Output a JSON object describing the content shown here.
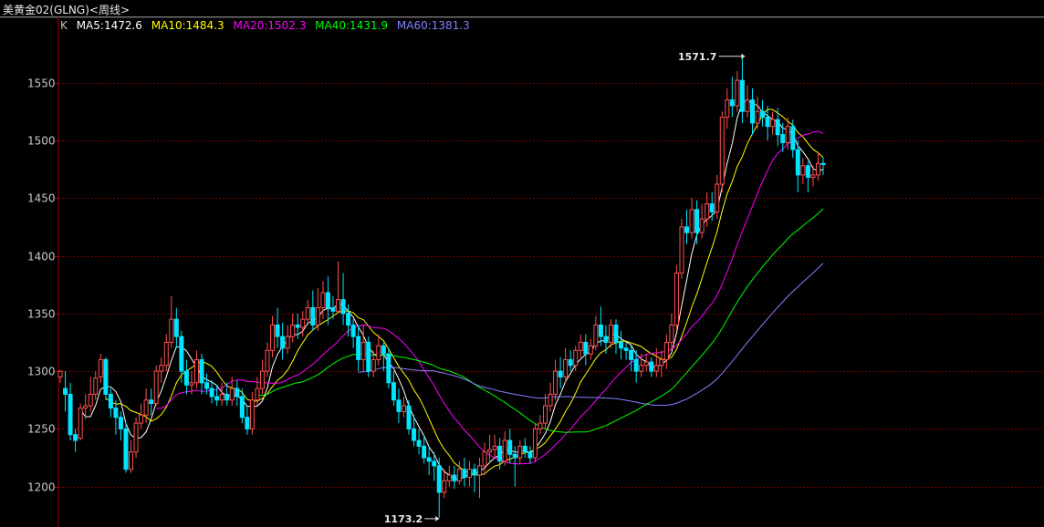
{
  "window": {
    "title": "美黄金02(GLNG)<周线>"
  },
  "legend": {
    "k_label": "K",
    "items": [
      {
        "label": "MA5:1472.6",
        "color": "#ffffff"
      },
      {
        "label": "MA10:1484.3",
        "color": "#ffff00"
      },
      {
        "label": "MA20:1502.3",
        "color": "#ff00ff"
      },
      {
        "label": "MA40:1431.9",
        "color": "#00ff00"
      },
      {
        "label": "MA60:1381.3",
        "color": "#8080ff"
      }
    ]
  },
  "colors": {
    "up": "#ff5050",
    "down": "#00e5ff",
    "grid": "#7a0000",
    "axis": "#b00000"
  },
  "chart_data": {
    "type": "candlestick",
    "ylim": [
      1165,
      1590
    ],
    "yticks": [
      1200,
      1250,
      1300,
      1350,
      1400,
      1450,
      1500,
      1550
    ],
    "high_marker": "1571.7",
    "low_marker": "1173.2",
    "high": 1571.7,
    "low": 1173.2,
    "candles": [
      [
        1295,
        1300,
        1290,
        1301
      ],
      [
        1285,
        1280,
        1265,
        1300
      ],
      [
        1280,
        1245,
        1240,
        1290
      ],
      [
        1245,
        1240,
        1230,
        1250
      ],
      [
        1242,
        1268,
        1240,
        1272
      ],
      [
        1268,
        1270,
        1258,
        1280
      ],
      [
        1270,
        1280,
        1265,
        1295
      ],
      [
        1280,
        1294,
        1275,
        1300
      ],
      [
        1295,
        1310,
        1290,
        1315
      ],
      [
        1310,
        1280,
        1275,
        1312
      ],
      [
        1280,
        1268,
        1260,
        1285
      ],
      [
        1268,
        1260,
        1245,
        1275
      ],
      [
        1260,
        1250,
        1240,
        1265
      ],
      [
        1250,
        1215,
        1212,
        1256
      ],
      [
        1215,
        1230,
        1212,
        1240
      ],
      [
        1230,
        1255,
        1225,
        1260
      ],
      [
        1255,
        1262,
        1250,
        1272
      ],
      [
        1262,
        1275,
        1255,
        1285
      ],
      [
        1275,
        1272,
        1262,
        1285
      ],
      [
        1272,
        1300,
        1270,
        1305
      ],
      [
        1300,
        1305,
        1290,
        1312
      ],
      [
        1305,
        1325,
        1300,
        1332
      ],
      [
        1325,
        1345,
        1320,
        1365
      ],
      [
        1345,
        1330,
        1320,
        1355
      ],
      [
        1330,
        1300,
        1290,
        1335
      ],
      [
        1300,
        1288,
        1280,
        1310
      ],
      [
        1288,
        1290,
        1280,
        1300
      ],
      [
        1290,
        1310,
        1285,
        1318
      ],
      [
        1310,
        1290,
        1280,
        1315
      ],
      [
        1290,
        1285,
        1280,
        1298
      ],
      [
        1285,
        1278,
        1272,
        1292
      ],
      [
        1278,
        1275,
        1270,
        1288
      ],
      [
        1275,
        1280,
        1270,
        1290
      ],
      [
        1280,
        1275,
        1270,
        1290
      ],
      [
        1275,
        1285,
        1270,
        1295
      ],
      [
        1285,
        1278,
        1270,
        1292
      ],
      [
        1278,
        1260,
        1255,
        1285
      ],
      [
        1260,
        1250,
        1245,
        1270
      ],
      [
        1250,
        1275,
        1245,
        1282
      ],
      [
        1275,
        1285,
        1270,
        1295
      ],
      [
        1285,
        1300,
        1280,
        1310
      ],
      [
        1300,
        1318,
        1295,
        1325
      ],
      [
        1318,
        1340,
        1312,
        1348
      ],
      [
        1340,
        1330,
        1320,
        1355
      ],
      [
        1330,
        1320,
        1310,
        1342
      ],
      [
        1320,
        1330,
        1315,
        1340
      ],
      [
        1330,
        1340,
        1325,
        1350
      ],
      [
        1340,
        1338,
        1328,
        1350
      ],
      [
        1338,
        1345,
        1330,
        1352
      ],
      [
        1345,
        1355,
        1340,
        1362
      ],
      [
        1355,
        1340,
        1335,
        1370
      ],
      [
        1340,
        1355,
        1335,
        1372
      ],
      [
        1355,
        1368,
        1345,
        1378
      ],
      [
        1368,
        1355,
        1340,
        1382
      ],
      [
        1355,
        1352,
        1345,
        1365
      ],
      [
        1352,
        1362,
        1350,
        1395
      ],
      [
        1362,
        1350,
        1340,
        1385
      ],
      [
        1350,
        1340,
        1330,
        1358
      ],
      [
        1340,
        1330,
        1320,
        1345
      ],
      [
        1330,
        1310,
        1300,
        1340
      ],
      [
        1310,
        1325,
        1300,
        1340
      ],
      [
        1325,
        1300,
        1295,
        1330
      ],
      [
        1300,
        1310,
        1295,
        1318
      ],
      [
        1310,
        1322,
        1305,
        1332
      ],
      [
        1322,
        1315,
        1300,
        1325
      ],
      [
        1315,
        1290,
        1285,
        1320
      ],
      [
        1290,
        1275,
        1270,
        1300
      ],
      [
        1275,
        1265,
        1255,
        1285
      ],
      [
        1265,
        1270,
        1260,
        1278
      ],
      [
        1270,
        1250,
        1245,
        1275
      ],
      [
        1250,
        1240,
        1235,
        1262
      ],
      [
        1240,
        1235,
        1228,
        1250
      ],
      [
        1235,
        1225,
        1220,
        1245
      ],
      [
        1225,
        1222,
        1210,
        1235
      ],
      [
        1222,
        1218,
        1205,
        1230
      ],
      [
        1218,
        1195,
        1173,
        1225
      ],
      [
        1195,
        1205,
        1190,
        1215
      ],
      [
        1205,
        1210,
        1200,
        1218
      ],
      [
        1210,
        1205,
        1198,
        1218
      ],
      [
        1205,
        1215,
        1202,
        1222
      ],
      [
        1215,
        1208,
        1200,
        1225
      ],
      [
        1208,
        1215,
        1200,
        1222
      ],
      [
        1215,
        1210,
        1195,
        1220
      ],
      [
        1210,
        1218,
        1190,
        1225
      ],
      [
        1218,
        1230,
        1210,
        1238
      ],
      [
        1230,
        1232,
        1220,
        1245
      ],
      [
        1232,
        1235,
        1225,
        1245
      ],
      [
        1235,
        1222,
        1215,
        1242
      ],
      [
        1222,
        1240,
        1218,
        1248
      ],
      [
        1240,
        1228,
        1220,
        1250
      ],
      [
        1228,
        1225,
        1200,
        1235
      ],
      [
        1225,
        1235,
        1220,
        1240
      ],
      [
        1235,
        1230,
        1225,
        1242
      ],
      [
        1230,
        1225,
        1220,
        1235
      ],
      [
        1225,
        1250,
        1222,
        1255
      ],
      [
        1250,
        1255,
        1245,
        1262
      ],
      [
        1255,
        1270,
        1250,
        1280
      ],
      [
        1270,
        1280,
        1265,
        1290
      ],
      [
        1280,
        1300,
        1275,
        1310
      ],
      [
        1300,
        1295,
        1285,
        1312
      ],
      [
        1295,
        1310,
        1290,
        1320
      ],
      [
        1310,
        1305,
        1300,
        1318
      ],
      [
        1305,
        1318,
        1300,
        1322
      ],
      [
        1318,
        1325,
        1312,
        1332
      ],
      [
        1325,
        1315,
        1305,
        1332
      ],
      [
        1315,
        1322,
        1310,
        1328
      ],
      [
        1322,
        1340,
        1318,
        1348
      ],
      [
        1340,
        1330,
        1322,
        1356
      ],
      [
        1330,
        1325,
        1315,
        1340
      ],
      [
        1325,
        1340,
        1320,
        1345
      ],
      [
        1340,
        1325,
        1315,
        1345
      ],
      [
        1325,
        1320,
        1310,
        1335
      ],
      [
        1320,
        1318,
        1310,
        1325
      ],
      [
        1318,
        1310,
        1300,
        1322
      ],
      [
        1310,
        1300,
        1290,
        1318
      ],
      [
        1300,
        1305,
        1295,
        1315
      ],
      [
        1305,
        1308,
        1300,
        1315
      ],
      [
        1308,
        1300,
        1295,
        1312
      ],
      [
        1300,
        1305,
        1295,
        1320
      ],
      [
        1305,
        1310,
        1295,
        1318
      ],
      [
        1310,
        1325,
        1302,
        1332
      ],
      [
        1325,
        1340,
        1318,
        1350
      ],
      [
        1340,
        1385,
        1335,
        1392
      ],
      [
        1385,
        1425,
        1380,
        1432
      ],
      [
        1425,
        1420,
        1410,
        1440
      ],
      [
        1420,
        1440,
        1415,
        1450
      ],
      [
        1440,
        1420,
        1410,
        1448
      ],
      [
        1420,
        1432,
        1415,
        1445
      ],
      [
        1432,
        1445,
        1425,
        1455
      ],
      [
        1445,
        1438,
        1430,
        1455
      ],
      [
        1438,
        1462,
        1432,
        1470
      ],
      [
        1462,
        1520,
        1455,
        1525
      ],
      [
        1520,
        1535,
        1510,
        1545
      ],
      [
        1535,
        1530,
        1520,
        1555
      ],
      [
        1530,
        1552,
        1525,
        1560
      ],
      [
        1552,
        1525,
        1515,
        1572
      ],
      [
        1525,
        1535,
        1520,
        1548
      ],
      [
        1535,
        1515,
        1505,
        1545
      ],
      [
        1515,
        1525,
        1510,
        1538
      ],
      [
        1525,
        1520,
        1512,
        1535
      ],
      [
        1520,
        1512,
        1500,
        1530
      ],
      [
        1512,
        1518,
        1505,
        1525
      ],
      [
        1518,
        1505,
        1495,
        1528
      ],
      [
        1505,
        1498,
        1490,
        1515
      ],
      [
        1498,
        1512,
        1492,
        1520
      ],
      [
        1512,
        1492,
        1485,
        1518
      ],
      [
        1492,
        1470,
        1455,
        1500
      ],
      [
        1470,
        1478,
        1462,
        1485
      ],
      [
        1478,
        1468,
        1455,
        1482
      ],
      [
        1468,
        1470,
        1460,
        1478
      ],
      [
        1470,
        1480,
        1465,
        1490
      ],
      [
        1480,
        1479,
        1470,
        1485
      ]
    ]
  }
}
